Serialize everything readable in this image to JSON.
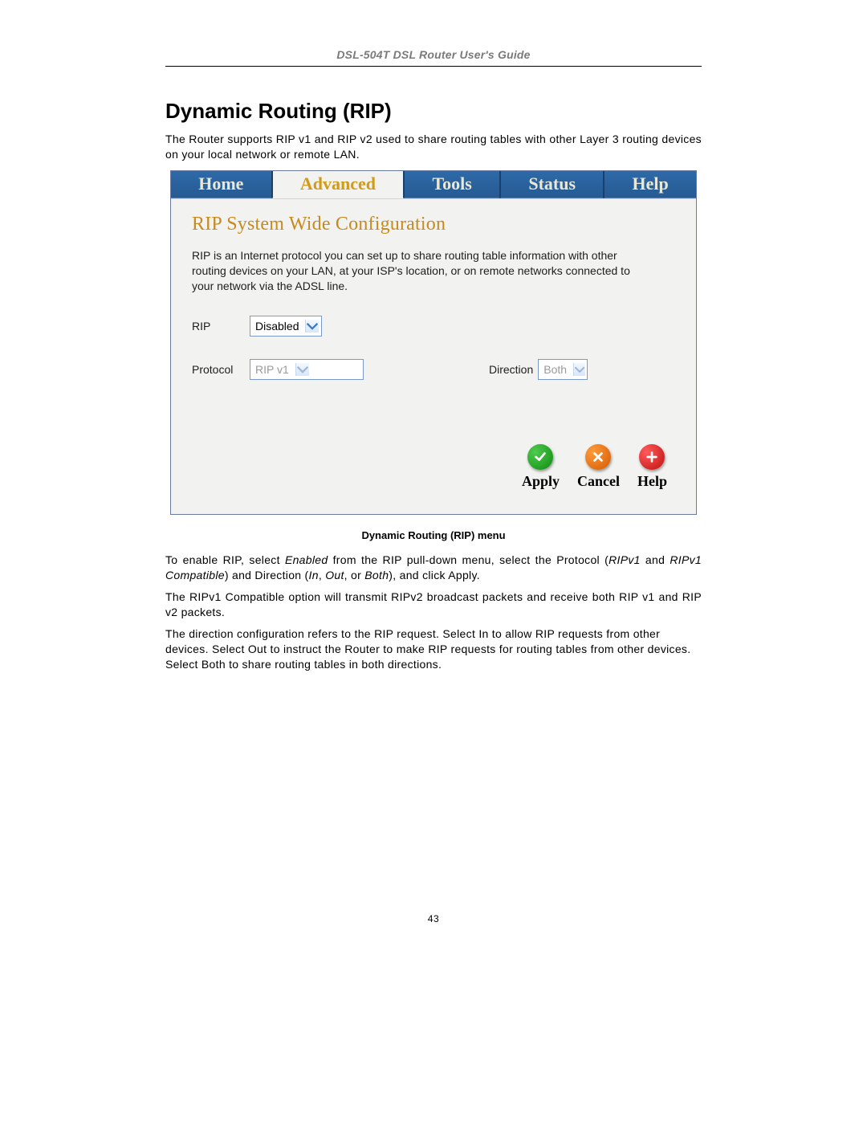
{
  "header": {
    "title": "DSL-504T DSL Router User's Guide"
  },
  "section": {
    "title": "Dynamic Routing (RIP)",
    "intro": "The Router supports RIP v1 and RIP v2 used to share routing tables with other Layer 3 routing devices on your local network or remote LAN."
  },
  "figure": {
    "tabs": {
      "home": "Home",
      "advanced": "Advanced",
      "tools": "Tools",
      "status": "Status",
      "help": "Help"
    },
    "panel": {
      "title": "RIP System Wide Configuration",
      "description": "RIP is an Internet protocol you can set up to share routing table information with other routing devices on your LAN, at your ISP's location, or on remote networks connected to your network via the ADSL line.",
      "fields": {
        "rip_label": "RIP",
        "rip_value": "Disabled",
        "protocol_label": "Protocol",
        "protocol_value": "RIP v1",
        "direction_label": "Direction",
        "direction_value": "Both"
      },
      "actions": {
        "apply": "Apply",
        "cancel": "Cancel",
        "help": "Help"
      }
    },
    "caption": "Dynamic Routing (RIP) menu"
  },
  "body_text": {
    "p1_a": "To enable RIP, select ",
    "p1_enabled": "Enabled",
    "p1_b": " from the RIP pull-down menu, select the Protocol (",
    "p1_ripv1": "RIPv1",
    "p1_c": " and ",
    "p1_ripv1c": "RIPv1 Compatible",
    "p1_d": ") and Direction (",
    "p1_in": "In",
    "p1_e": ", ",
    "p1_out": "Out",
    "p1_f": ", or ",
    "p1_both": "Both",
    "p1_g": "), and click Apply.",
    "p2": "The RIPv1 Compatible option will transmit RIPv2 broadcast packets and receive both RIP v1 and RIP v2 packets.",
    "p3": "The direction configuration refers to the RIP request. Select In to allow RIP requests from other devices. Select Out to instruct the Router to make RIP requests for routing tables from other devices. Select Both to share routing tables in both directions."
  },
  "page_number": "43"
}
